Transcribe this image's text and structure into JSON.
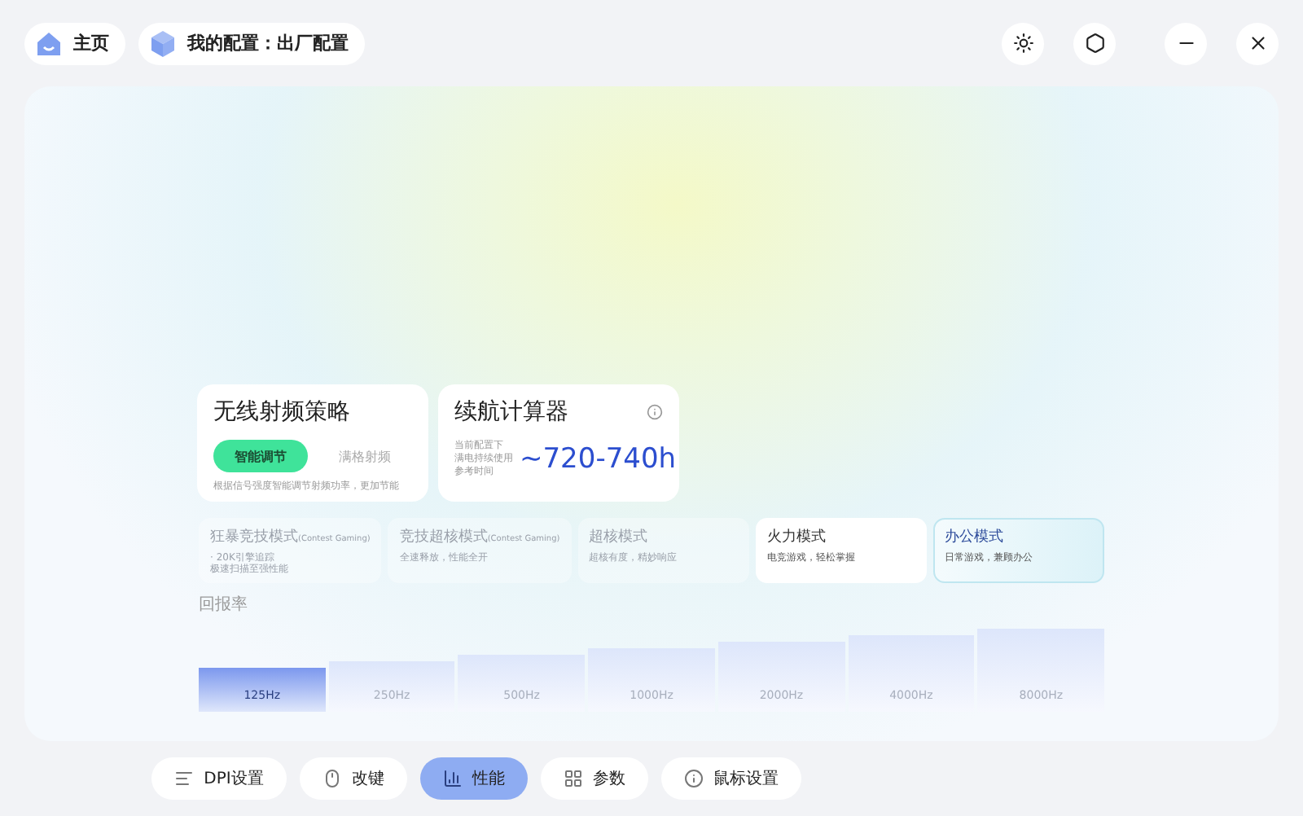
{
  "top_bar": {
    "home": {
      "label": "主页"
    },
    "profile": {
      "label": "我的配置：出厂配置"
    }
  },
  "wireless_card": {
    "title": "无线射频策略",
    "options": [
      {
        "label": "智能调节",
        "selected": true
      },
      {
        "label": "满格射频",
        "selected": false
      }
    ],
    "description": "根据信号强度智能调节射频功率，更加节能"
  },
  "battery_card": {
    "title": "续航计算器",
    "note": [
      "当前配置下",
      "满电持续使用",
      "参考时间"
    ],
    "value": "~720-740h"
  },
  "modes": [
    {
      "name": "狂暴竞技模式",
      "tag": "(Contest Gaming)",
      "description": [
        "· 20K引擎追踪",
        "极速扫描至强性能"
      ],
      "disabled": true,
      "selected": false
    },
    {
      "name": "竞技超核模式",
      "tag": "(Contest Gaming)",
      "description": [
        "全速释放，性能全开"
      ],
      "disabled": true,
      "selected": false
    },
    {
      "name": "超核模式",
      "description": [
        "超核有度，精妙响应"
      ],
      "disabled": true,
      "selected": false
    },
    {
      "name": "火力模式",
      "description": [
        "电竞游戏，轻松掌握"
      ],
      "disabled": false,
      "selected": false
    },
    {
      "name": "办公模式",
      "description": [
        "日常游戏，兼顾办公"
      ],
      "disabled": false,
      "selected": true
    }
  ],
  "polling_rate": {
    "label": "回报率",
    "steps": [
      {
        "label": "125Hz",
        "selected": true
      },
      {
        "label": "250Hz",
        "selected": false
      },
      {
        "label": "500Hz",
        "selected": false
      },
      {
        "label": "1000Hz",
        "selected": false
      },
      {
        "label": "2000Hz",
        "selected": false
      },
      {
        "label": "4000Hz",
        "selected": false
      },
      {
        "label": "8000Hz",
        "selected": false
      }
    ]
  },
  "bottom_nav": [
    {
      "label": "DPI设置",
      "selected": false
    },
    {
      "label": "改键",
      "selected": false
    },
    {
      "label": "性能",
      "selected": true
    },
    {
      "label": "参数",
      "selected": false
    },
    {
      "label": "鼠标设置",
      "selected": false
    }
  ]
}
